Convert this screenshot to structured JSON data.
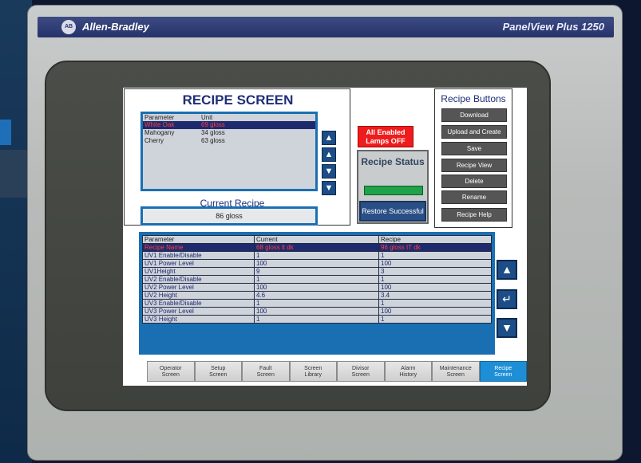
{
  "brand": {
    "logo_text": "AB",
    "company": "Allen-Bradley",
    "model": "PanelView Plus 1250"
  },
  "recipe_screen": {
    "title": "RECIPE SCREEN",
    "list_headers": [
      "Parameter",
      "Unit"
    ],
    "list_rows": [
      {
        "name": "White Oak",
        "unit": "69 gloss"
      },
      {
        "name": "Mahogany",
        "unit": "34 gloss"
      },
      {
        "name": "Cherry",
        "unit": "63 gloss"
      }
    ],
    "current_recipe_label": "Current Recipe",
    "current_recipe_value": "86 gloss"
  },
  "lamp": {
    "text": "All Enabled Lamps OFF",
    "color": "#ee1c1c"
  },
  "status": {
    "title": "Recipe Status",
    "button": "Restore Successful",
    "bar_color": "#1ea24a"
  },
  "recipe_buttons": {
    "title": "Recipe Buttons",
    "items": [
      "Download",
      "Upload and Create",
      "Save",
      "Recipe View",
      "Delete",
      "Rename",
      "Recipe Help"
    ]
  },
  "table": {
    "headers": [
      "Parameter",
      "Current",
      "Recipe"
    ],
    "rows": [
      [
        "Recipe Name",
        "68 gloss lt dk",
        "96 gloss IT dk"
      ],
      [
        "UV1 Enable/Disable",
        "1",
        "1"
      ],
      [
        "UV1 Power Level",
        "100",
        "100"
      ],
      [
        "UV1Height",
        "9",
        "3"
      ],
      [
        "UV2 Enable/Disable",
        "1",
        "1"
      ],
      [
        "UV2  Power Level",
        "100",
        "100"
      ],
      [
        "UV2 Height",
        "4.6",
        "3.4"
      ],
      [
        "UV3 Enable/Disable",
        "1",
        "1"
      ],
      [
        "UV3 Power Level",
        "100",
        "100"
      ],
      [
        "UV3 Height",
        "1",
        "1"
      ]
    ]
  },
  "nav": [
    {
      "line1": "Operator",
      "line2": "Screen"
    },
    {
      "line1": "Setup",
      "line2": "Screen"
    },
    {
      "line1": "Fault",
      "line2": "Screen"
    },
    {
      "line1": "Screen",
      "line2": "Library"
    },
    {
      "line1": "Divisor",
      "line2": "Screen"
    },
    {
      "line1": "Alarm",
      "line2": "History"
    },
    {
      "line1": "Maintenance",
      "line2": "Screen"
    },
    {
      "line1": "Recipe",
      "line2": "Screen"
    }
  ],
  "active_nav": "Recipe Screen",
  "accent_color": "#1a6fb3"
}
